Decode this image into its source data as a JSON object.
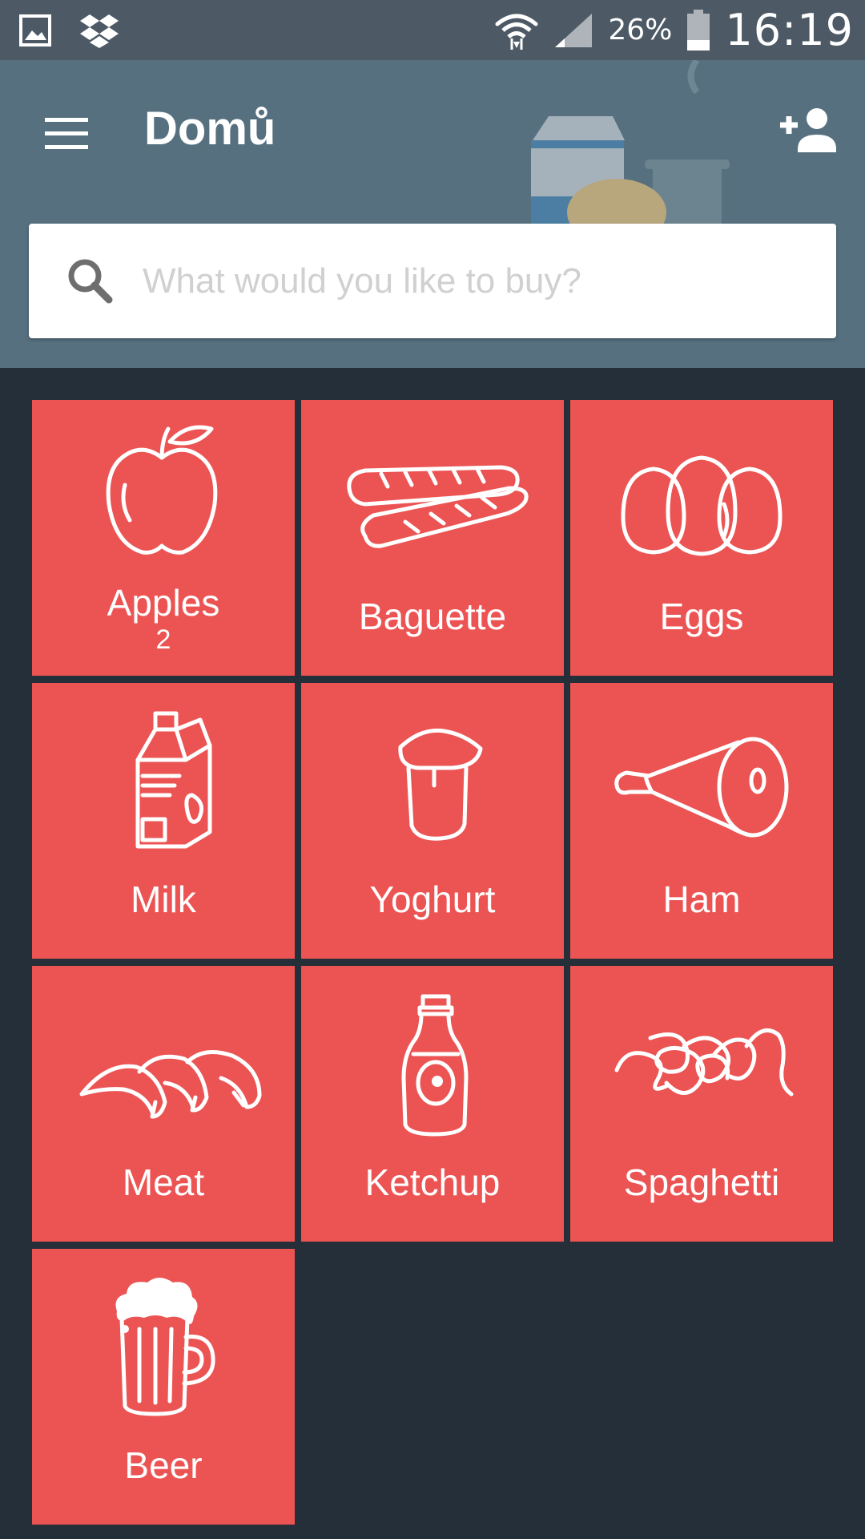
{
  "status_bar": {
    "battery_percent": "26%",
    "clock": "16:19",
    "icons": [
      "gallery-icon",
      "dropbox-icon",
      "wifi-icon",
      "signal-icon",
      "battery-icon"
    ]
  },
  "app_bar": {
    "title": "Domů",
    "menu_icon": "hamburger-menu-icon",
    "add_user_icon": "add-person-icon"
  },
  "search": {
    "placeholder": "What would you like to buy?",
    "value": ""
  },
  "items": [
    {
      "label": "Apples",
      "quantity": "2",
      "icon": "apple-icon"
    },
    {
      "label": "Baguette",
      "icon": "baguette-icon"
    },
    {
      "label": "Eggs",
      "icon": "eggs-icon"
    },
    {
      "label": "Milk",
      "icon": "milk-carton-icon"
    },
    {
      "label": "Yoghurt",
      "icon": "yoghurt-icon"
    },
    {
      "label": "Ham",
      "icon": "ham-icon"
    },
    {
      "label": "Meat",
      "icon": "meat-icon"
    },
    {
      "label": "Ketchup",
      "icon": "ketchup-icon"
    },
    {
      "label": "Spaghetti",
      "icon": "spaghetti-icon"
    },
    {
      "label": "Beer",
      "icon": "beer-mug-icon"
    }
  ],
  "colors": {
    "background": "#252f39",
    "app_bar": "#56707f",
    "status_bar": "#4d5a66",
    "tile": "#ec5353"
  }
}
